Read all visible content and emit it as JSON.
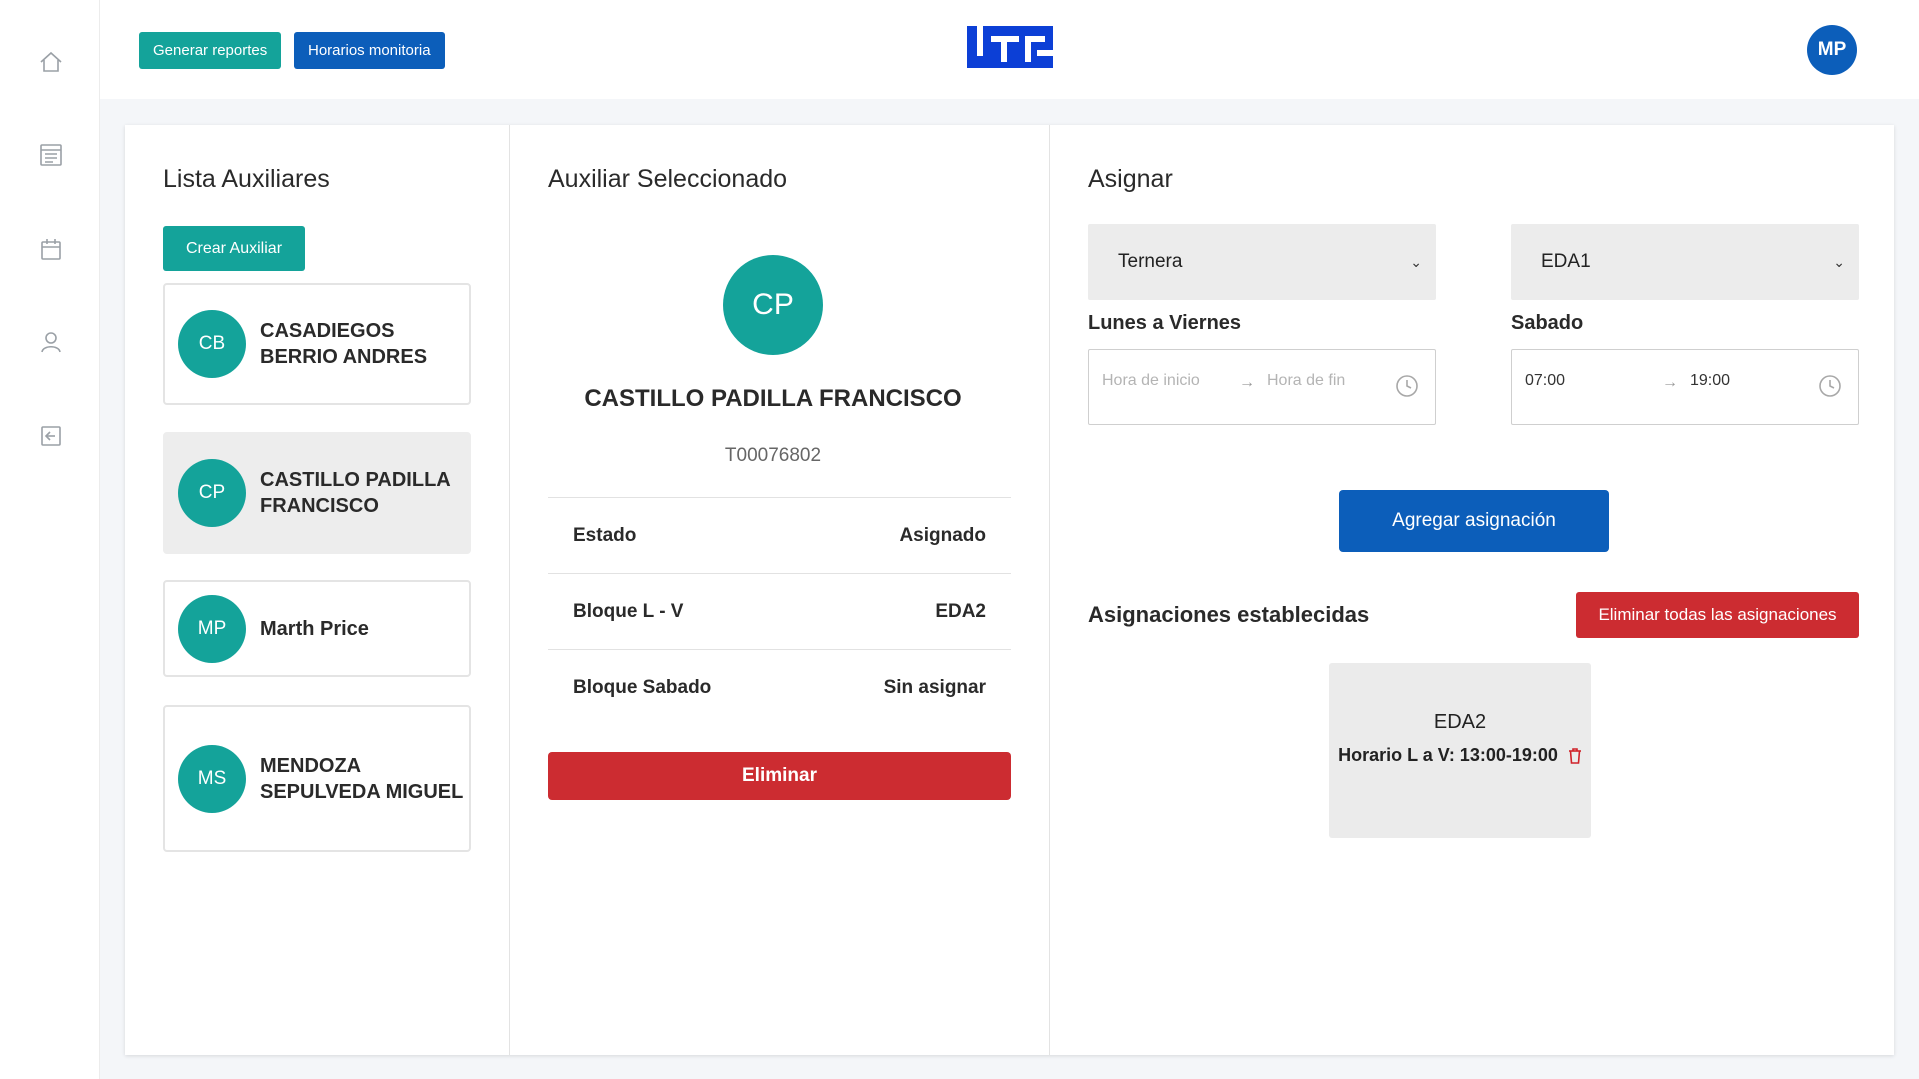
{
  "topbar": {
    "reports_button": "Generar reportes",
    "schedule_button": "Horarios monitoria",
    "user_initials": "MP"
  },
  "sidebar": {
    "icons": [
      "home-icon",
      "list-icon",
      "calendar-icon",
      "user-icon",
      "logout-icon"
    ]
  },
  "list_panel": {
    "title": "Lista Auxiliares",
    "create_button": "Crear Auxiliar",
    "items": [
      {
        "initials": "CB",
        "name": "CASADIEGOS BERRIO ANDRES",
        "selected": false
      },
      {
        "initials": "CP",
        "name": "CASTILLO PADILLA FRANCISCO",
        "selected": true
      },
      {
        "initials": "MP",
        "name": "Marth Price",
        "selected": false
      },
      {
        "initials": "MS",
        "name": "MENDOZA SEPULVEDA MIGUEL",
        "selected": false
      }
    ]
  },
  "selected_panel": {
    "title": "Auxiliar Seleccionado",
    "initials": "CP",
    "name": "CASTILLO PADILLA FRANCISCO",
    "code": "T00076802",
    "rows": [
      {
        "label": "Estado",
        "value": "Asignado"
      },
      {
        "label": "Bloque L - V",
        "value": "EDA2"
      },
      {
        "label": "Bloque Sabado",
        "value": "Sin asignar"
      }
    ],
    "delete_button": "Eliminar"
  },
  "assign_panel": {
    "title": "Asignar",
    "weekday_select": "Ternera",
    "saturday_select": "EDA1",
    "weekday_label": "Lunes a Viernes",
    "saturday_label": "Sabado",
    "weekday_start_placeholder": "Hora de inicio",
    "weekday_end_placeholder": "Hora de fin",
    "saturday_start": "07:00",
    "saturday_end": "19:00",
    "add_button": "Agregar asignación",
    "established_title": "Asignaciones establecidas",
    "clear_button": "Eliminar todas las asignaciones",
    "assignments": [
      {
        "name": "EDA2",
        "schedule": "Horario L a V: 13:00-19:00"
      }
    ]
  },
  "colors": {
    "teal": "#14a39a",
    "blue": "#0c5eba",
    "red": "#cc2c31"
  }
}
